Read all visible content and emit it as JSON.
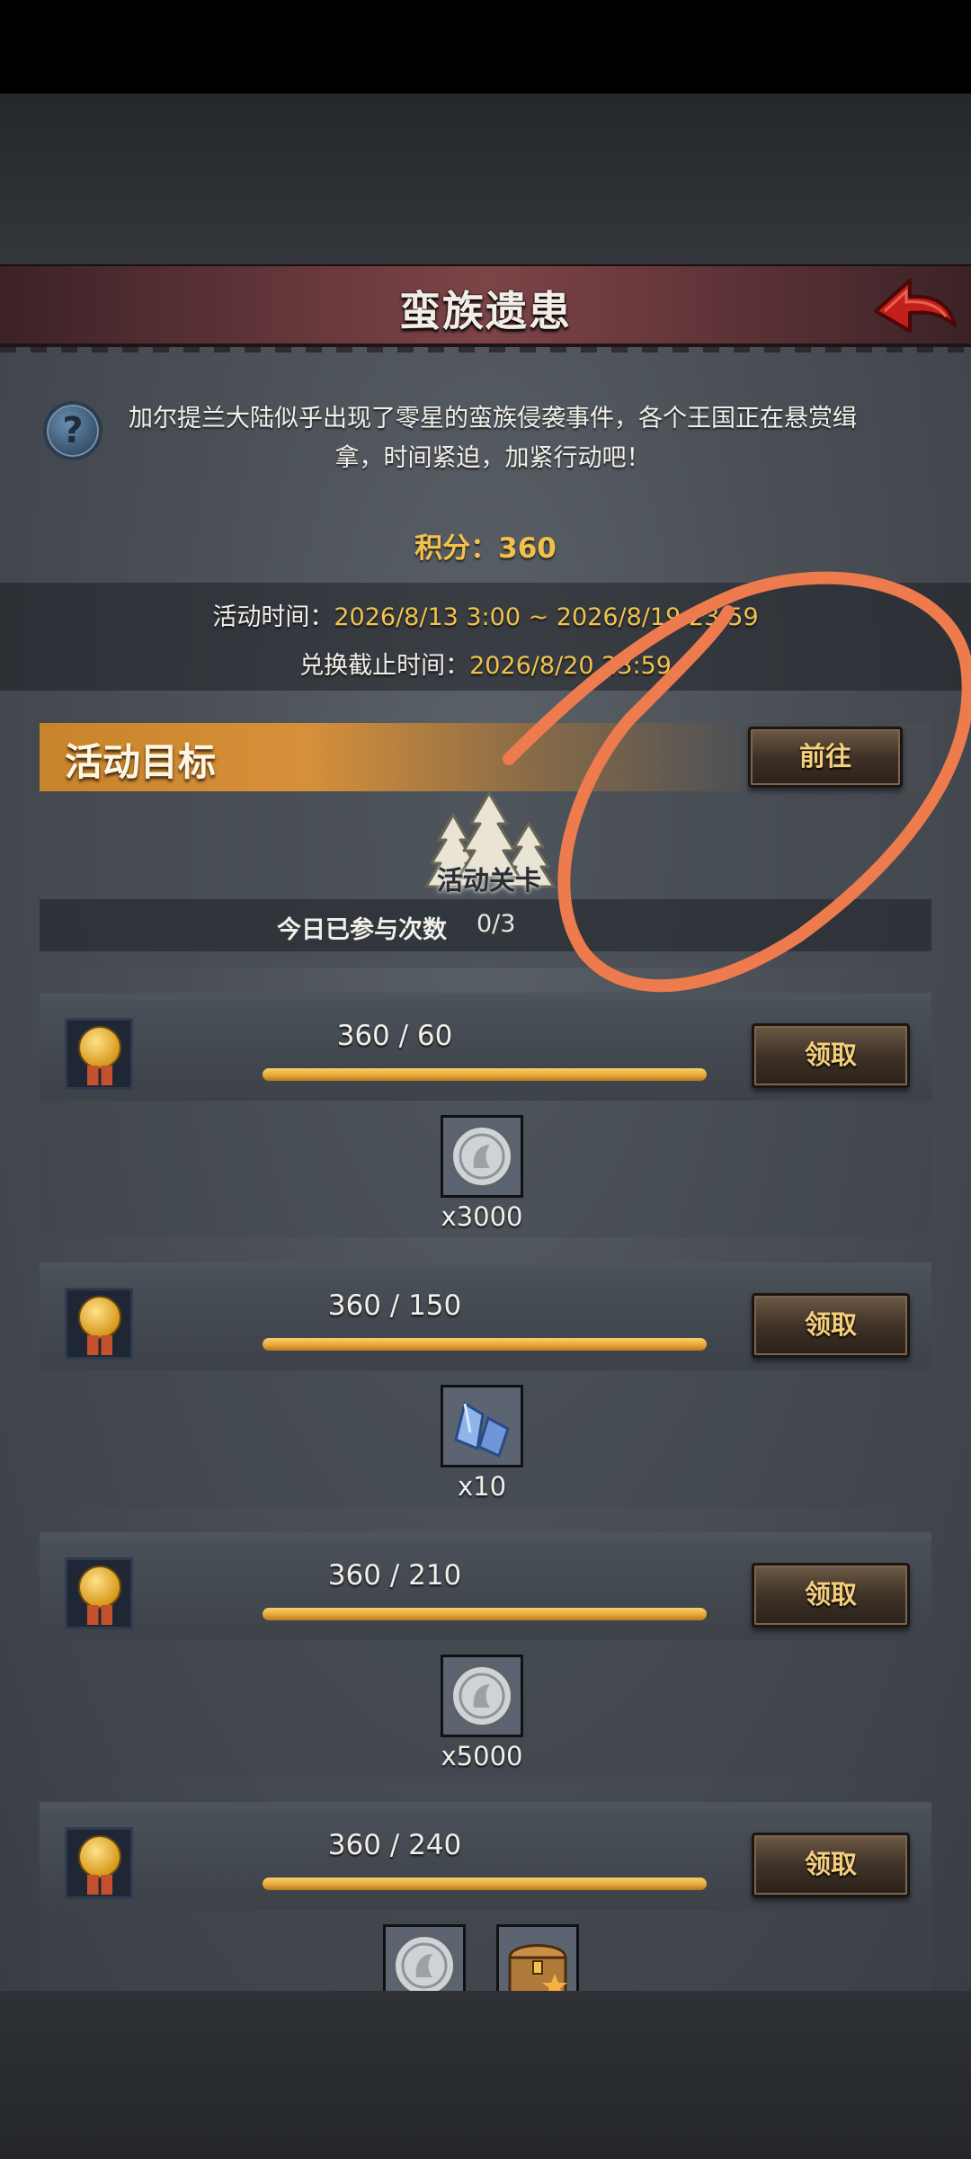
{
  "header": {
    "title": "蛮族遗患"
  },
  "intro": {
    "text": "加尔提兰大陆似乎出现了零星的蛮族侵袭事件，各个王国正在悬赏缉拿，时间紧迫，加紧行动吧！"
  },
  "score": {
    "label": "积分：",
    "value": "360"
  },
  "times": {
    "activity_label": "活动时间：",
    "activity_value": "2026/8/13 3:00 ~ 2026/8/19 23:59",
    "exchange_label": "兑换截止时间：",
    "exchange_value": "2026/8/20 23:59"
  },
  "goal": {
    "title": "活动目标",
    "go_label": "前往",
    "stage_label": "活动关卡",
    "participation_label": "今日已参与次数",
    "participation_value": "0/3"
  },
  "rewards": [
    {
      "progress": "360 / 60",
      "claim_label": "领取",
      "fill_fraction": 1.0,
      "items": [
        {
          "icon": "silver-coin-icon",
          "qty": "x3000"
        }
      ]
    },
    {
      "progress": "360 / 150",
      "claim_label": "领取",
      "fill_fraction": 1.0,
      "items": [
        {
          "icon": "crystal-icon",
          "qty": "x10"
        }
      ]
    },
    {
      "progress": "360 / 210",
      "claim_label": "领取",
      "fill_fraction": 1.0,
      "items": [
        {
          "icon": "silver-coin-icon",
          "qty": "x5000"
        }
      ]
    },
    {
      "progress": "360 / 240",
      "claim_label": "领取",
      "fill_fraction": 1.0,
      "items": [
        {
          "icon": "silver-coin-icon",
          "qty": ""
        },
        {
          "icon": "treasure-chest-icon",
          "qty": ""
        }
      ]
    }
  ],
  "colors": {
    "accent_gold": "#f2c14a",
    "title_bar": "#6b3a3e",
    "goal_header": "#d6903a",
    "annotation_stroke": "#ee7b4d"
  }
}
